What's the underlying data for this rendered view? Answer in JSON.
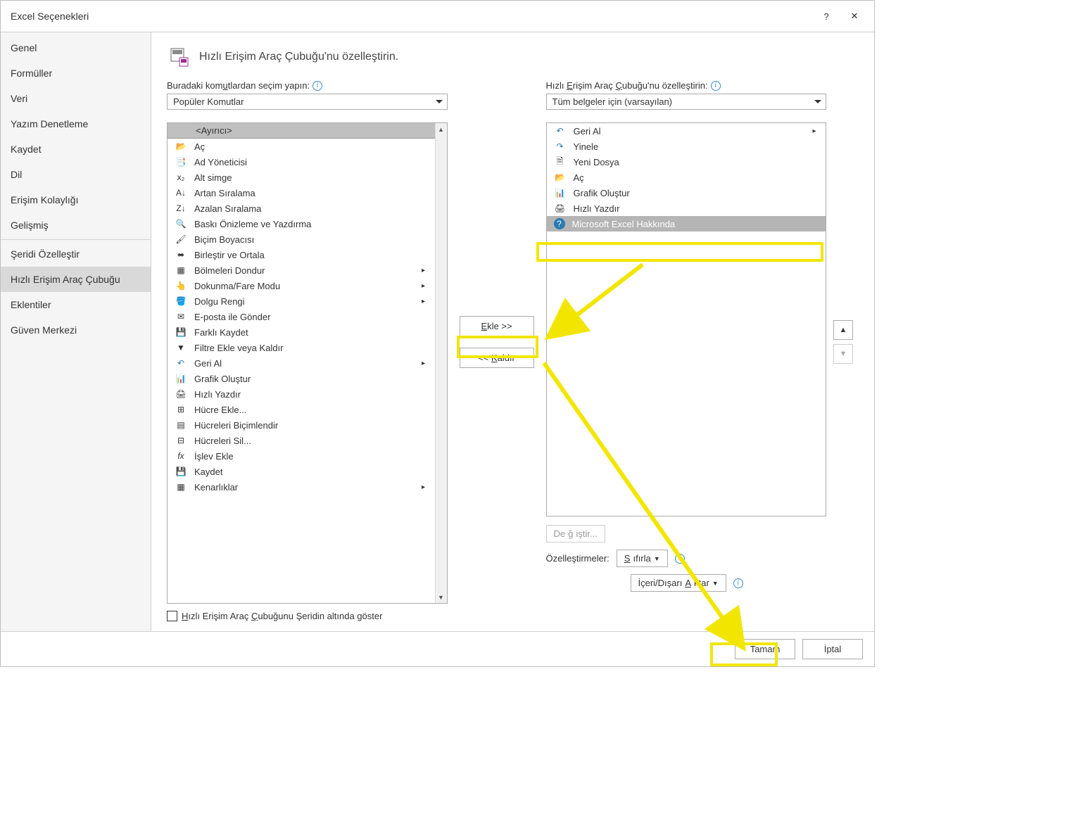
{
  "title": "Excel Seçenekleri",
  "help_icon": "?",
  "close_icon": "✕",
  "sidebar": {
    "items": [
      {
        "label": "Genel"
      },
      {
        "label": "Formüller"
      },
      {
        "label": "Veri"
      },
      {
        "label": "Yazım Denetleme"
      },
      {
        "label": "Kaydet"
      },
      {
        "label": "Dil"
      },
      {
        "label": "Erişim Kolaylığı"
      },
      {
        "label": "Gelişmiş"
      },
      {
        "label": "Şeridi Özelleştir"
      },
      {
        "label": "Hızlı Erişim Araç Çubuğu"
      },
      {
        "label": "Eklentiler"
      },
      {
        "label": "Güven Merkezi"
      }
    ]
  },
  "header": {
    "title": "Hızlı Erişim Araç Çubuğu'nu özelleştirin."
  },
  "left": {
    "label": "Buradaki komutlardan seçim yapın:",
    "dropdown": "Popüler Komutlar",
    "separator_label": "<Ayırıcı>",
    "items": [
      {
        "label": "Aç",
        "icon": "open-folder"
      },
      {
        "label": "Ad Yöneticisi",
        "icon": "name-manager"
      },
      {
        "label": "Alt simge",
        "icon": "subscript"
      },
      {
        "label": "Artan Sıralama",
        "icon": "sort-asc"
      },
      {
        "label": "Azalan Sıralama",
        "icon": "sort-desc"
      },
      {
        "label": "Baskı Önizleme ve Yazdırma",
        "icon": "print-preview"
      },
      {
        "label": "Biçim Boyacısı",
        "icon": "format-painter"
      },
      {
        "label": "Birleştir ve Ortala",
        "icon": "merge-center"
      },
      {
        "label": "Bölmeleri Dondur",
        "icon": "freeze-panes",
        "submenu": true
      },
      {
        "label": "Dokunma/Fare Modu",
        "icon": "touch-mouse",
        "submenu": true
      },
      {
        "label": "Dolgu Rengi",
        "icon": "fill-color",
        "submenu": true
      },
      {
        "label": "E-posta ile Gönder",
        "icon": "email"
      },
      {
        "label": "Farklı Kaydet",
        "icon": "save-as"
      },
      {
        "label": "Filtre Ekle veya Kaldır",
        "icon": "filter"
      },
      {
        "label": "Geri Al",
        "icon": "undo",
        "submenu": true
      },
      {
        "label": "Grafik Oluştur",
        "icon": "chart"
      },
      {
        "label": "Hızlı Yazdır",
        "icon": "quick-print"
      },
      {
        "label": "Hücre Ekle...",
        "icon": "insert-cells"
      },
      {
        "label": "Hücreleri Biçimlendir",
        "icon": "format-cells"
      },
      {
        "label": "Hücreleri Sil...",
        "icon": "delete-cells"
      },
      {
        "label": "İşlev Ekle",
        "icon": "fx"
      },
      {
        "label": "Kaydet",
        "icon": "save"
      },
      {
        "label": "Kenarlıklar",
        "icon": "borders",
        "submenu": true
      }
    ]
  },
  "right": {
    "label": "Hızlı Erişim Araç Çubuğu'nu özelleştirin:",
    "dropdown": "Tüm belgeler için (varsayılan)",
    "items": [
      {
        "label": "Geri Al",
        "icon": "undo",
        "submenu": true
      },
      {
        "label": "Yinele",
        "icon": "redo"
      },
      {
        "label": "Yeni Dosya",
        "icon": "new-file"
      },
      {
        "label": "Aç",
        "icon": "open-folder"
      },
      {
        "label": "Grafik Oluştur",
        "icon": "chart"
      },
      {
        "label": "Hızlı Yazdır",
        "icon": "quick-print"
      },
      {
        "label": "Microsoft Excel Hakkında",
        "icon": "help-about",
        "selected": true
      }
    ]
  },
  "mid": {
    "add": "Ekle >>",
    "remove": "<< Kaldır"
  },
  "modify_btn": "Değiştir...",
  "customizations_label": "Özelleştirmeler:",
  "reset_btn": "Sıfırla",
  "import_export_btn": "İçeri/Dışarı Aktar",
  "checkbox_label": "Hızlı Erişim Araç Çubuğunu Şeridin altında göster",
  "footer": {
    "ok": "Tamam",
    "cancel": "İptal"
  },
  "colors": {
    "highlight": "#f2e600"
  }
}
